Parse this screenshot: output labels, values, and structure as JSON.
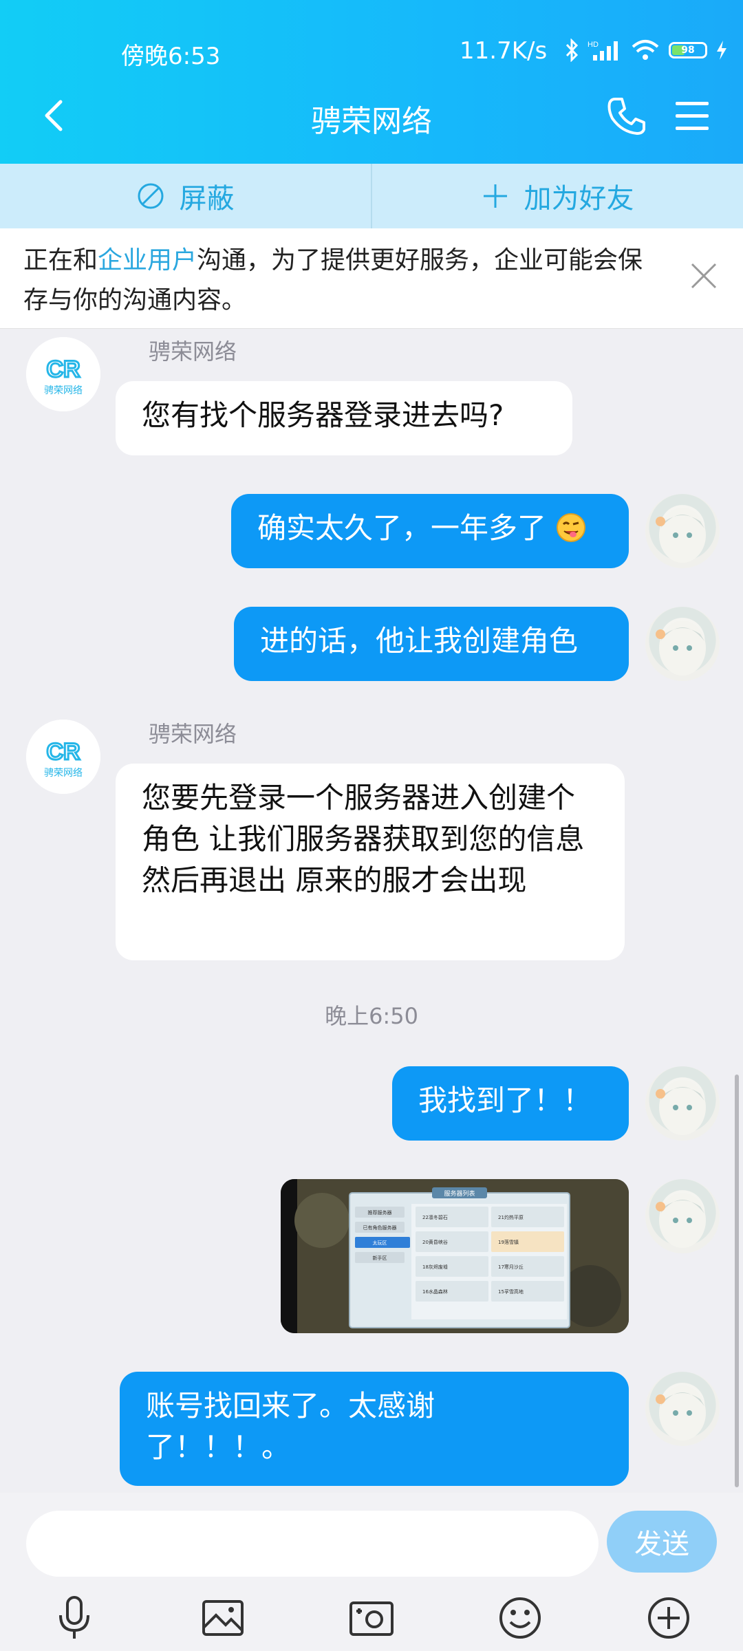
{
  "status": {
    "time": "傍晚6:53",
    "speed": "11.7K/s",
    "battery": "98"
  },
  "header": {
    "title": "骋荣网络"
  },
  "actions": {
    "block": "屏蔽",
    "add_friend": "加为好友"
  },
  "notice": {
    "pre": "正在和",
    "highlight": "企业用户",
    "post": "沟通，为了提供更好服务，企业可能会保存与你的沟通内容。"
  },
  "messages": {
    "sender1": "骋荣网络",
    "m1": "您有找个服务器登录进去吗?",
    "m2": "确实太久了，一年多了",
    "m3": "进的话，他让我创建角色",
    "sender2": "骋荣网络",
    "m4": "您要先登录一个服务器进入创建个角色 让我们服务器获取到您的信息 然后再退出 原来的服才会出现",
    "timestamp": "晚上6:50",
    "m5": "我找到了！！",
    "m6": "账号找回来了。太感谢了！！！。"
  },
  "screenshot_image": {
    "title": "服务器列表",
    "tabs": [
      "推荐服务器",
      "已有角色服务器",
      "太玩区",
      "新手区"
    ],
    "servers": [
      "22凛冬碧石",
      "21灼热平原",
      "20黄昏峡谷",
      "19落雪镇",
      "18灰烬废墟",
      "17寒月沙丘",
      "16水晶森林",
      "15孚雪高地"
    ]
  },
  "input": {
    "send_label": "发送"
  },
  "colors": {
    "header_start": "#12cdf6",
    "bubble_out": "#0d99f6",
    "accent": "#24a8e0"
  }
}
